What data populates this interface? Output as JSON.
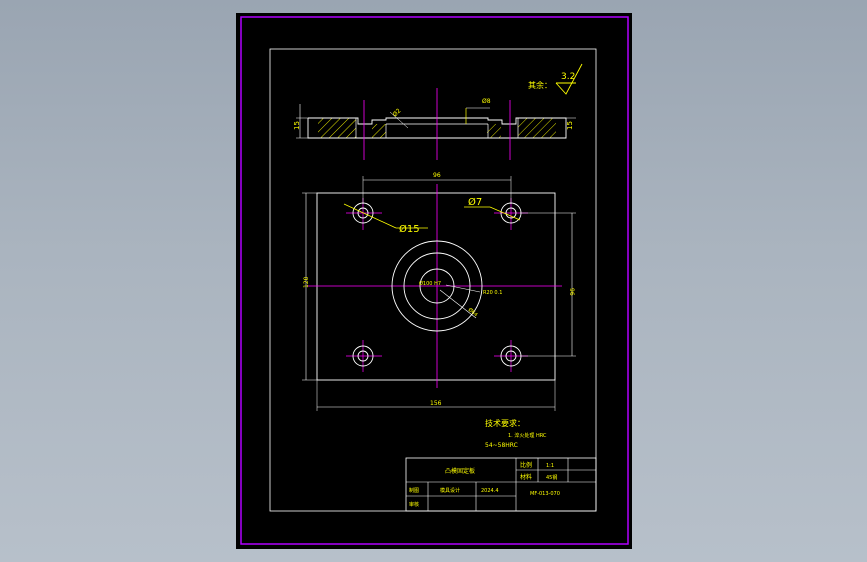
{
  "colors": {
    "viewport_bg": "#000000",
    "outer_frame": "#b000ff",
    "inner_frame": "#ffffff",
    "geometry": "#ffffff",
    "centerline": "#ff00ff",
    "dimension_text": "#ffff00",
    "dimension_line": "#ffffff",
    "hatch": "#ffff00"
  },
  "drawing": {
    "roughness_note": "其余：",
    "roughness_value": "3.2",
    "section_dims": {
      "left_height": "15",
      "right_height": "15",
      "diag": "Ø2",
      "counterbore": "Ø8"
    },
    "plan_dims": {
      "hole_spacing_x": "96",
      "hole_spacing_y": "96",
      "plate_height": "120",
      "plate_width": "156",
      "small_hole": "Ø7",
      "big_hole": "Ø15",
      "center_bore": "Ø100 H7",
      "ring_inner": "R20 0.1",
      "ring_outer": "Ø64"
    },
    "tech_req": {
      "title": "技术要求：",
      "line1": "1. 淬火处理 HRC",
      "line2": "54~58HRC"
    },
    "title_block": {
      "part_name": "凸模固定板",
      "scale_label": "比例",
      "scale_value": "1:1",
      "material_label": "材料",
      "material_value": "45钢",
      "designer_label": "制图",
      "checker_label": "审核",
      "date_value": "2024.4",
      "school": "模具设计",
      "drawing_no": "MF-013-070"
    }
  }
}
